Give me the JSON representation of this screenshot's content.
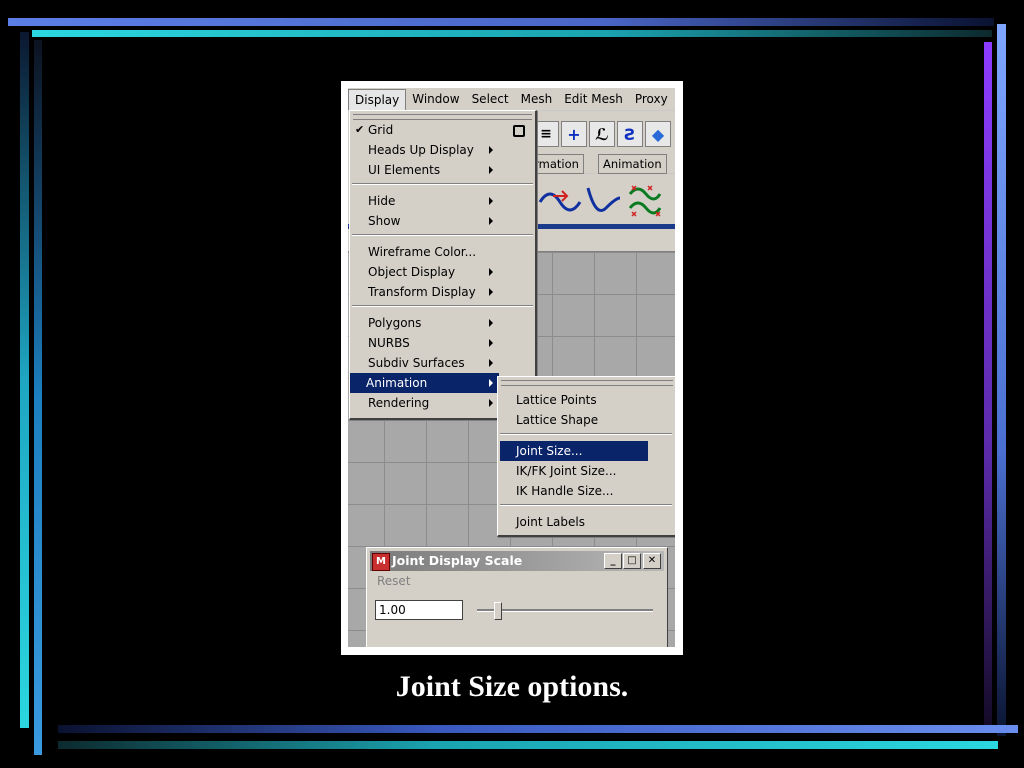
{
  "menubar": {
    "items": [
      "Display",
      "Window",
      "Select",
      "Mesh",
      "Edit Mesh",
      "Proxy"
    ]
  },
  "shelf": {
    "tabs": [
      "formation",
      "Animation"
    ]
  },
  "display_menu": {
    "items": [
      {
        "label": "Grid",
        "checked": true,
        "option_box": true
      },
      {
        "label": "Heads Up Display",
        "submenu": true
      },
      {
        "label": "UI Elements",
        "submenu": true
      },
      {
        "label": "Hide",
        "submenu": true
      },
      {
        "label": "Show",
        "submenu": true
      },
      {
        "label": "Wireframe Color..."
      },
      {
        "label": "Object Display",
        "submenu": true
      },
      {
        "label": "Transform Display",
        "submenu": true
      },
      {
        "label": "Polygons",
        "submenu": true
      },
      {
        "label": "NURBS",
        "submenu": true
      },
      {
        "label": "Subdiv Surfaces",
        "submenu": true
      },
      {
        "label": "Animation",
        "submenu": true,
        "highlighted": true
      },
      {
        "label": "Rendering",
        "submenu": true
      }
    ]
  },
  "animation_submenu": {
    "items": [
      {
        "label": "Lattice Points"
      },
      {
        "label": "Lattice Shape"
      },
      {
        "label": "Joint Size...",
        "highlighted": true
      },
      {
        "label": "IK/FK Joint Size..."
      },
      {
        "label": "IK Handle Size..."
      },
      {
        "label": "Joint Labels"
      }
    ]
  },
  "joint_window": {
    "title": "Joint Display Scale",
    "reset_label": "Reset",
    "value": "1.00",
    "slider_fraction": 0.12
  },
  "caption": "Joint Size options.",
  "colors": {
    "menu_highlight": "#0a246a",
    "menu_bg": "#d4d0c8"
  }
}
